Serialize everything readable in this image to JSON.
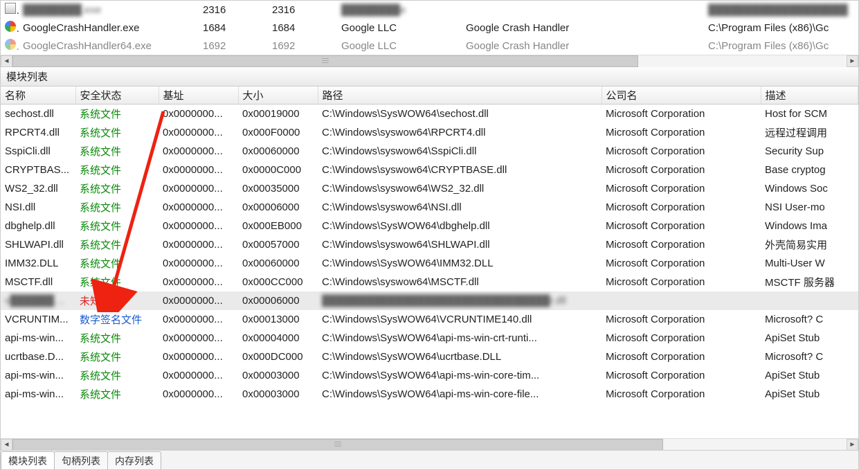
{
  "process_rows": [
    {
      "icon": "app",
      "name": "████████.exe",
      "pid": "2316",
      "ppid": "2316",
      "company": "████████e",
      "desc": "",
      "path": "███████████████████",
      "blurName": true,
      "blurCompany": true,
      "blurPath": true
    },
    {
      "icon": "google",
      "name": "GoogleCrashHandler.exe",
      "pid": "1684",
      "ppid": "1684",
      "company": "Google LLC",
      "desc": "Google Crash Handler",
      "path": "C:\\Program Files (x86)\\Gc"
    },
    {
      "icon": "google",
      "name": "GoogleCrashHandler64.exe",
      "pid": "1692",
      "ppid": "1692",
      "company": "Google LLC",
      "desc": "Google Crash Handler",
      "path": "C:\\Program Files (x86)\\Gc"
    }
  ],
  "module_pane_title": "模块列表",
  "module_columns": {
    "name": "名称",
    "status": "安全状态",
    "base": "基址",
    "size": "大小",
    "path": "路径",
    "company": "公司名",
    "desc": "描述"
  },
  "module_rows": [
    {
      "name": "sechost.dll",
      "status": "系统文件",
      "statusClass": "sys",
      "base": "0x0000000...",
      "size": "0x00019000",
      "path": "C:\\Windows\\SysWOW64\\sechost.dll",
      "company": "Microsoft Corporation",
      "desc": "Host for SCM"
    },
    {
      "name": "RPCRT4.dll",
      "status": "系统文件",
      "statusClass": "sys",
      "base": "0x0000000...",
      "size": "0x000F0000",
      "path": "C:\\Windows\\syswow64\\RPCRT4.dll",
      "company": "Microsoft Corporation",
      "desc": "远程过程调用"
    },
    {
      "name": "SspiCli.dll",
      "status": "系统文件",
      "statusClass": "sys",
      "base": "0x0000000...",
      "size": "0x00060000",
      "path": "C:\\Windows\\syswow64\\SspiCli.dll",
      "company": "Microsoft Corporation",
      "desc": "Security Sup"
    },
    {
      "name": "CRYPTBAS...",
      "status": "系统文件",
      "statusClass": "sys",
      "base": "0x0000000...",
      "size": "0x0000C000",
      "path": "C:\\Windows\\syswow64\\CRYPTBASE.dll",
      "company": "Microsoft Corporation",
      "desc": "Base cryptog"
    },
    {
      "name": "WS2_32.dll",
      "status": "系统文件",
      "statusClass": "sys",
      "base": "0x0000000...",
      "size": "0x00035000",
      "path": "C:\\Windows\\syswow64\\WS2_32.dll",
      "company": "Microsoft Corporation",
      "desc": "Windows Soc"
    },
    {
      "name": "NSI.dll",
      "status": "系统文件",
      "statusClass": "sys",
      "base": "0x0000000...",
      "size": "0x00006000",
      "path": "C:\\Windows\\syswow64\\NSI.dll",
      "company": "Microsoft Corporation",
      "desc": "NSI User-mo"
    },
    {
      "name": "dbghelp.dll",
      "status": "系统文件",
      "statusClass": "sys",
      "base": "0x0000000...",
      "size": "0x000EB000",
      "path": "C:\\Windows\\SysWOW64\\dbghelp.dll",
      "company": "Microsoft Corporation",
      "desc": "Windows Ima"
    },
    {
      "name": "SHLWAPI.dll",
      "status": "系统文件",
      "statusClass": "sys",
      "base": "0x0000000...",
      "size": "0x00057000",
      "path": "C:\\Windows\\syswow64\\SHLWAPI.dll",
      "company": "Microsoft Corporation",
      "desc": "外壳简易实用"
    },
    {
      "name": "IMM32.DLL",
      "status": "系统文件",
      "statusClass": "sys",
      "base": "0x0000000...",
      "size": "0x00060000",
      "path": "C:\\Windows\\SysWOW64\\IMM32.DLL",
      "company": "Microsoft Corporation",
      "desc": "Multi-User W"
    },
    {
      "name": "MSCTF.dll",
      "status": "系统文件",
      "statusClass": "sys",
      "base": "0x0000000...",
      "size": "0x000CC000",
      "path": "C:\\Windows\\syswow64\\MSCTF.dll",
      "company": "Microsoft Corporation",
      "desc": "MSCTF 服务器"
    },
    {
      "name": "v███████....",
      "status": "未知文件",
      "statusClass": "unknown",
      "base": "0x0000000...",
      "size": "0x00006000",
      "path": "███████████████████████████████r.dll",
      "company": "",
      "desc": "",
      "selected": true,
      "blurName": true,
      "blurPath": true
    },
    {
      "name": "VCRUNTIM...",
      "status": "数字签名文件",
      "statusClass": "signed",
      "base": "0x0000000...",
      "size": "0x00013000",
      "path": "C:\\Windows\\SysWOW64\\VCRUNTIME140.dll",
      "company": "Microsoft Corporation",
      "desc": "Microsoft? C"
    },
    {
      "name": "api-ms-win...",
      "status": "系统文件",
      "statusClass": "sys",
      "base": "0x0000000...",
      "size": "0x00004000",
      "path": "C:\\Windows\\SysWOW64\\api-ms-win-crt-runti...",
      "company": "Microsoft Corporation",
      "desc": "ApiSet Stub"
    },
    {
      "name": "ucrtbase.D...",
      "status": "系统文件",
      "statusClass": "sys",
      "base": "0x0000000...",
      "size": "0x000DC000",
      "path": "C:\\Windows\\SysWOW64\\ucrtbase.DLL",
      "company": "Microsoft Corporation",
      "desc": "Microsoft? C"
    },
    {
      "name": "api-ms-win...",
      "status": "系统文件",
      "statusClass": "sys",
      "base": "0x0000000...",
      "size": "0x00003000",
      "path": "C:\\Windows\\SysWOW64\\api-ms-win-core-tim...",
      "company": "Microsoft Corporation",
      "desc": "ApiSet Stub"
    },
    {
      "name": "api-ms-win...",
      "status": "系统文件",
      "statusClass": "sys",
      "base": "0x0000000...",
      "size": "0x00003000",
      "path": "C:\\Windows\\SysWOW64\\api-ms-win-core-file...",
      "company": "Microsoft Corporation",
      "desc": "ApiSet Stub"
    }
  ],
  "tabs": {
    "modules": "模块列表",
    "handles": "句柄列表",
    "memory": "内存列表"
  }
}
